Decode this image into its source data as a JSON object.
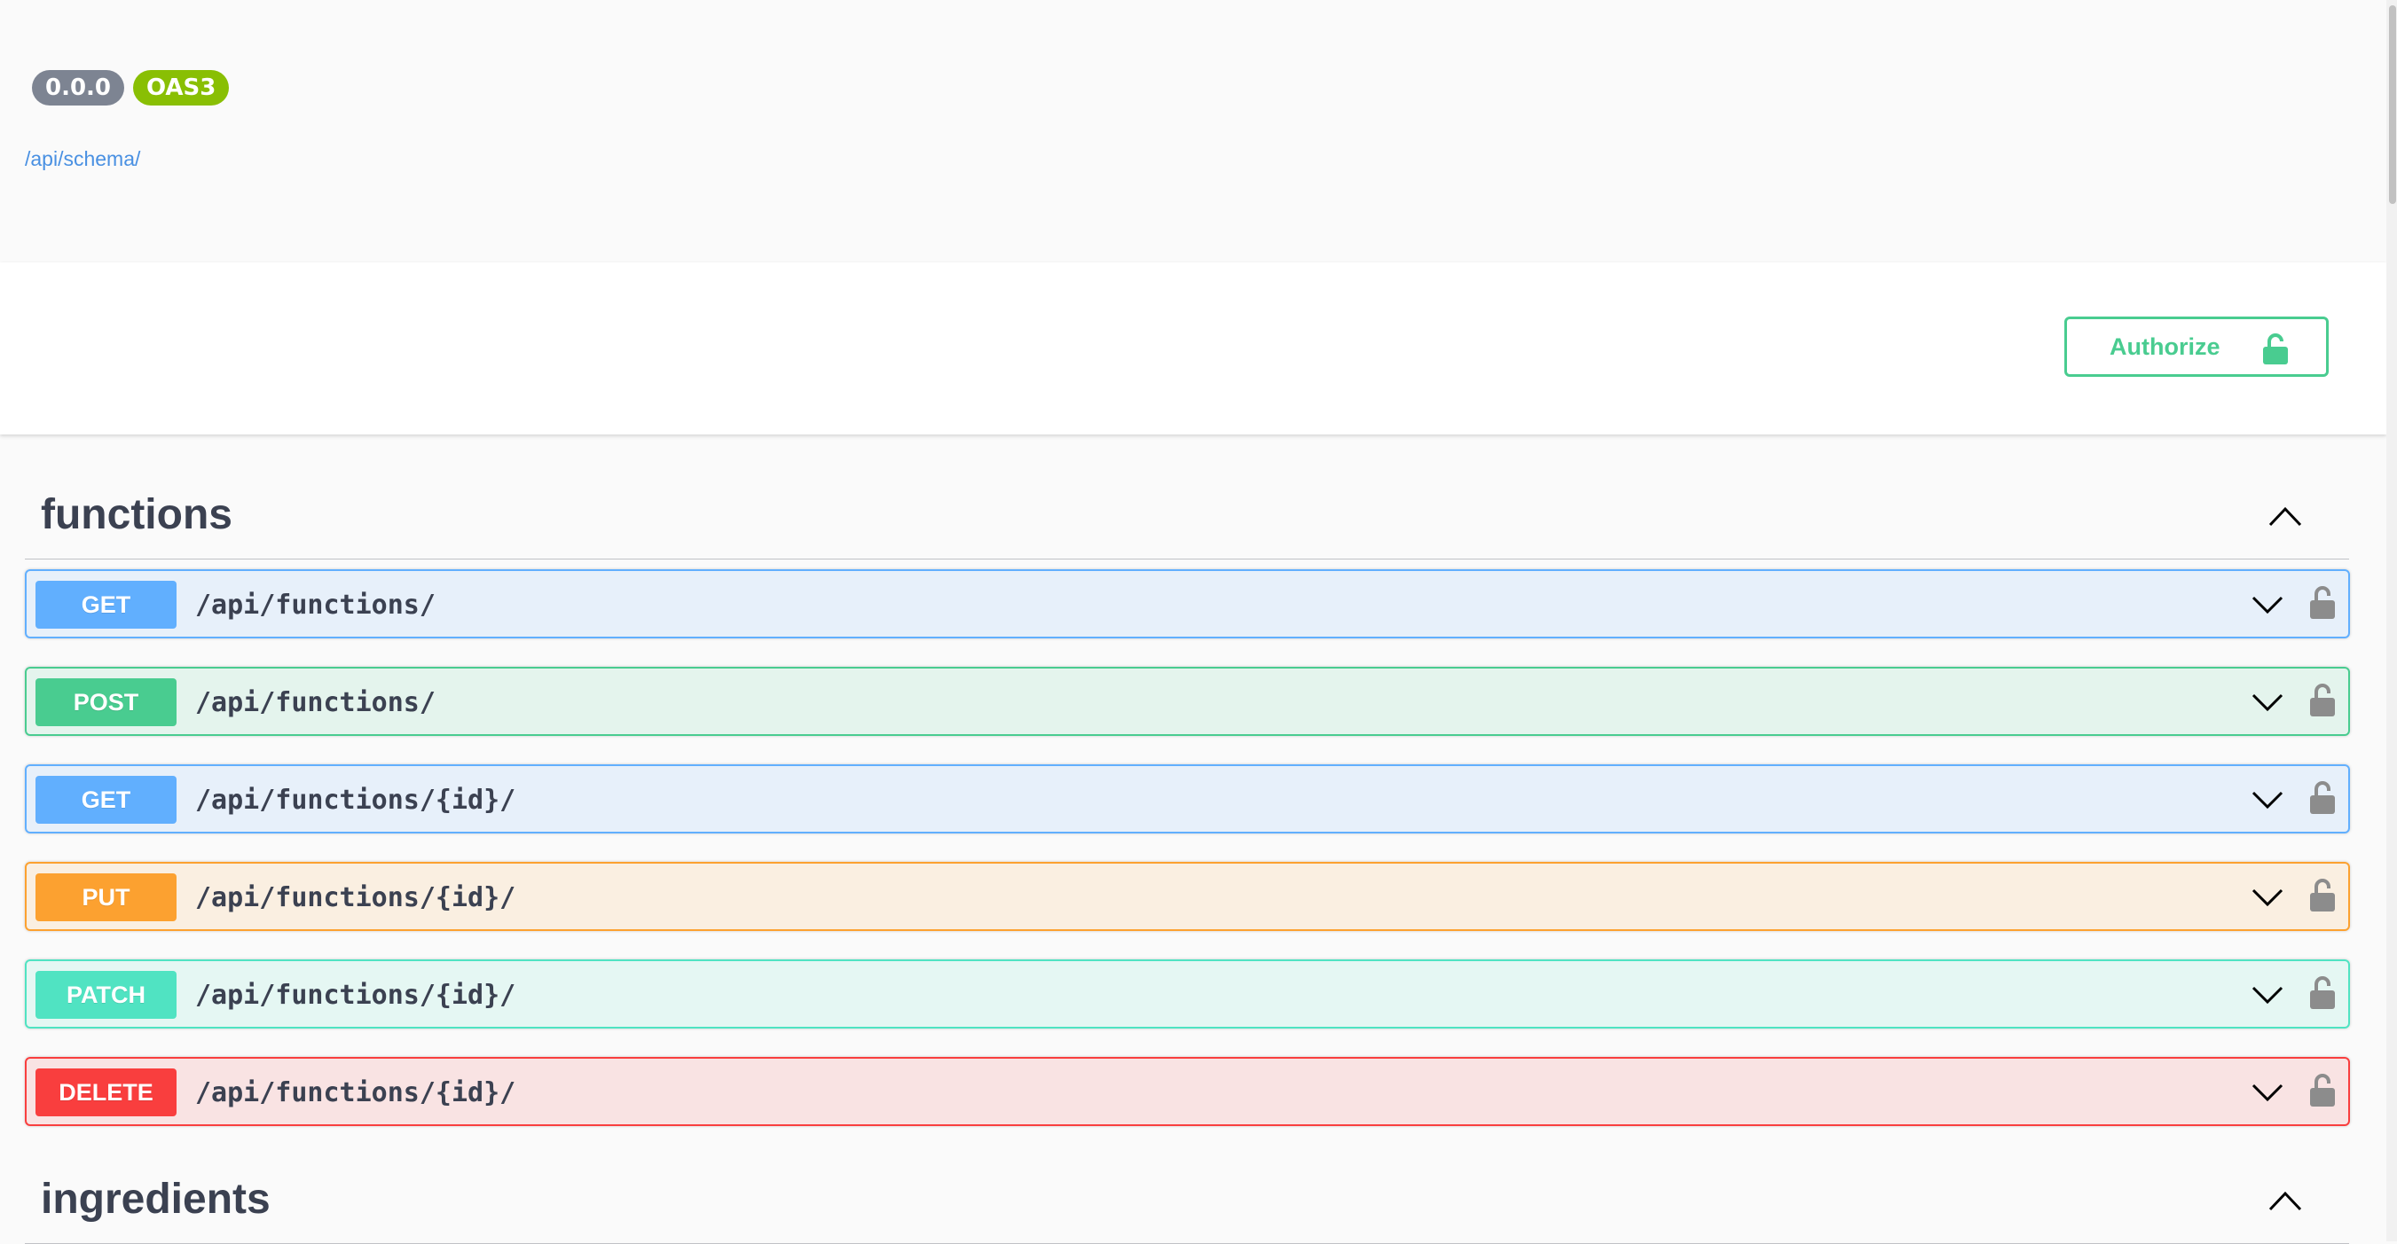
{
  "info": {
    "version": "0.0.0",
    "oas": "OAS3",
    "schema_url": "/api/schema/"
  },
  "scheme": {
    "authorize_label": "Authorize"
  },
  "tags": [
    {
      "name": "functions",
      "operations": [
        {
          "method": "GET",
          "path": "/api/functions/"
        },
        {
          "method": "POST",
          "path": "/api/functions/"
        },
        {
          "method": "GET",
          "path": "/api/functions/{id}/"
        },
        {
          "method": "PUT",
          "path": "/api/functions/{id}/"
        },
        {
          "method": "PATCH",
          "path": "/api/functions/{id}/"
        },
        {
          "method": "DELETE",
          "path": "/api/functions/{id}/"
        }
      ]
    },
    {
      "name": "ingredients",
      "operations": []
    }
  ],
  "colors": {
    "get": "#61affe",
    "post": "#49cc90",
    "put": "#fca130",
    "patch": "#50e3c2",
    "delete": "#f93e3e",
    "title": "#3b4151"
  },
  "icons": {
    "authorize": "unlocked-padlock-icon",
    "operation_lock": "unlocked-padlock-icon",
    "expand": "chevron-down-icon",
    "collapse": "chevron-up-icon"
  }
}
